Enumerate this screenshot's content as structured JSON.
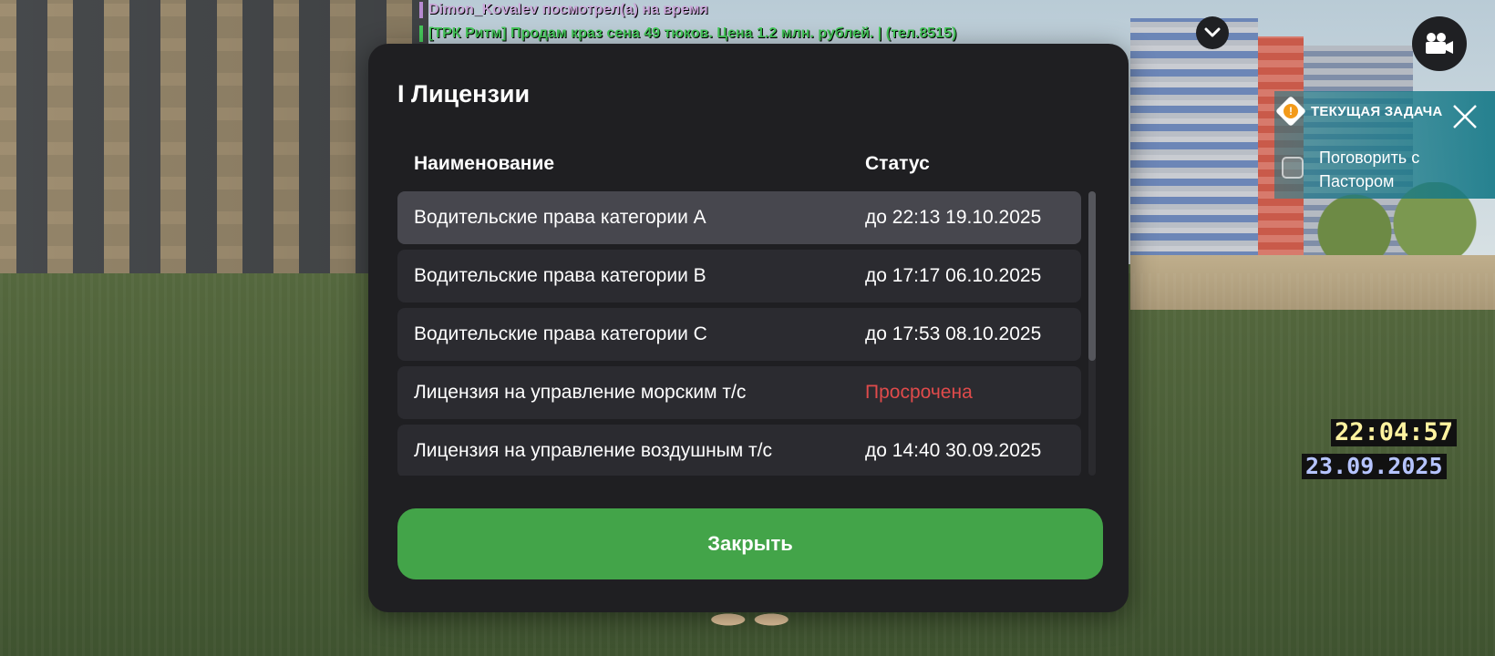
{
  "chat": [
    {
      "text": "Dimon_Kovalev посмотрел(а) на время",
      "color": "#c9a6d8",
      "bar": "#b58ad0"
    },
    {
      "text": "[ТРК Ритм] Продам краз сена 49 тюков. Цена 1.2 млн. рублей. | (тел.8515)",
      "color": "#45c85a",
      "bar": "#45c85a"
    }
  ],
  "header_buttons": {
    "collapse_icon": "chevron-down-icon",
    "camera_icon": "video-camera-icon"
  },
  "task": {
    "title": "ТЕКУЩАЯ ЗАДАЧА",
    "icon_glyph": "!",
    "text": "Поговорить с Пастором"
  },
  "clock": {
    "time": "22:04:57",
    "date": "23.09.2025"
  },
  "modal": {
    "title": "I Лицензии",
    "columns": {
      "name": "Наименование",
      "status": "Статус"
    },
    "rows": [
      {
        "name": "Водительские права категории A",
        "status": "до 22:13 19.10.2025",
        "expired": false,
        "active": true
      },
      {
        "name": "Водительские права категории B",
        "status": "до 17:17 06.10.2025",
        "expired": false,
        "active": false
      },
      {
        "name": "Водительские права категории C",
        "status": "до 17:53 08.10.2025",
        "expired": false,
        "active": false
      },
      {
        "name": "Лицензия на управление морским т/с",
        "status": "Просрочена",
        "expired": true,
        "active": false
      },
      {
        "name": "Лицензия на управление воздушным т/с",
        "status": "до 14:40 30.09.2025",
        "expired": false,
        "active": false
      }
    ],
    "close_label": "Закрыть"
  },
  "colors": {
    "accent": "#43a449",
    "expired": "#e04b4b",
    "modal_bg": "#1f1f22",
    "task_bg": "#14788a"
  }
}
